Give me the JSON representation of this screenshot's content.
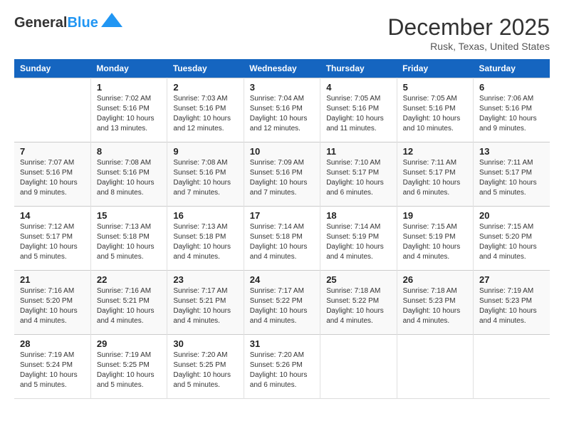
{
  "header": {
    "logo_general": "General",
    "logo_blue": "Blue",
    "month_title": "December 2025",
    "location": "Rusk, Texas, United States"
  },
  "days_of_week": [
    "Sunday",
    "Monday",
    "Tuesday",
    "Wednesday",
    "Thursday",
    "Friday",
    "Saturday"
  ],
  "weeks": [
    [
      {
        "number": "",
        "info": ""
      },
      {
        "number": "1",
        "info": "Sunrise: 7:02 AM\nSunset: 5:16 PM\nDaylight: 10 hours\nand 13 minutes."
      },
      {
        "number": "2",
        "info": "Sunrise: 7:03 AM\nSunset: 5:16 PM\nDaylight: 10 hours\nand 12 minutes."
      },
      {
        "number": "3",
        "info": "Sunrise: 7:04 AM\nSunset: 5:16 PM\nDaylight: 10 hours\nand 12 minutes."
      },
      {
        "number": "4",
        "info": "Sunrise: 7:05 AM\nSunset: 5:16 PM\nDaylight: 10 hours\nand 11 minutes."
      },
      {
        "number": "5",
        "info": "Sunrise: 7:05 AM\nSunset: 5:16 PM\nDaylight: 10 hours\nand 10 minutes."
      },
      {
        "number": "6",
        "info": "Sunrise: 7:06 AM\nSunset: 5:16 PM\nDaylight: 10 hours\nand 9 minutes."
      }
    ],
    [
      {
        "number": "7",
        "info": "Sunrise: 7:07 AM\nSunset: 5:16 PM\nDaylight: 10 hours\nand 9 minutes."
      },
      {
        "number": "8",
        "info": "Sunrise: 7:08 AM\nSunset: 5:16 PM\nDaylight: 10 hours\nand 8 minutes."
      },
      {
        "number": "9",
        "info": "Sunrise: 7:08 AM\nSunset: 5:16 PM\nDaylight: 10 hours\nand 7 minutes."
      },
      {
        "number": "10",
        "info": "Sunrise: 7:09 AM\nSunset: 5:16 PM\nDaylight: 10 hours\nand 7 minutes."
      },
      {
        "number": "11",
        "info": "Sunrise: 7:10 AM\nSunset: 5:17 PM\nDaylight: 10 hours\nand 6 minutes."
      },
      {
        "number": "12",
        "info": "Sunrise: 7:11 AM\nSunset: 5:17 PM\nDaylight: 10 hours\nand 6 minutes."
      },
      {
        "number": "13",
        "info": "Sunrise: 7:11 AM\nSunset: 5:17 PM\nDaylight: 10 hours\nand 5 minutes."
      }
    ],
    [
      {
        "number": "14",
        "info": "Sunrise: 7:12 AM\nSunset: 5:17 PM\nDaylight: 10 hours\nand 5 minutes."
      },
      {
        "number": "15",
        "info": "Sunrise: 7:13 AM\nSunset: 5:18 PM\nDaylight: 10 hours\nand 5 minutes."
      },
      {
        "number": "16",
        "info": "Sunrise: 7:13 AM\nSunset: 5:18 PM\nDaylight: 10 hours\nand 4 minutes."
      },
      {
        "number": "17",
        "info": "Sunrise: 7:14 AM\nSunset: 5:18 PM\nDaylight: 10 hours\nand 4 minutes."
      },
      {
        "number": "18",
        "info": "Sunrise: 7:14 AM\nSunset: 5:19 PM\nDaylight: 10 hours\nand 4 minutes."
      },
      {
        "number": "19",
        "info": "Sunrise: 7:15 AM\nSunset: 5:19 PM\nDaylight: 10 hours\nand 4 minutes."
      },
      {
        "number": "20",
        "info": "Sunrise: 7:15 AM\nSunset: 5:20 PM\nDaylight: 10 hours\nand 4 minutes."
      }
    ],
    [
      {
        "number": "21",
        "info": "Sunrise: 7:16 AM\nSunset: 5:20 PM\nDaylight: 10 hours\nand 4 minutes."
      },
      {
        "number": "22",
        "info": "Sunrise: 7:16 AM\nSunset: 5:21 PM\nDaylight: 10 hours\nand 4 minutes."
      },
      {
        "number": "23",
        "info": "Sunrise: 7:17 AM\nSunset: 5:21 PM\nDaylight: 10 hours\nand 4 minutes."
      },
      {
        "number": "24",
        "info": "Sunrise: 7:17 AM\nSunset: 5:22 PM\nDaylight: 10 hours\nand 4 minutes."
      },
      {
        "number": "25",
        "info": "Sunrise: 7:18 AM\nSunset: 5:22 PM\nDaylight: 10 hours\nand 4 minutes."
      },
      {
        "number": "26",
        "info": "Sunrise: 7:18 AM\nSunset: 5:23 PM\nDaylight: 10 hours\nand 4 minutes."
      },
      {
        "number": "27",
        "info": "Sunrise: 7:19 AM\nSunset: 5:23 PM\nDaylight: 10 hours\nand 4 minutes."
      }
    ],
    [
      {
        "number": "28",
        "info": "Sunrise: 7:19 AM\nSunset: 5:24 PM\nDaylight: 10 hours\nand 5 minutes."
      },
      {
        "number": "29",
        "info": "Sunrise: 7:19 AM\nSunset: 5:25 PM\nDaylight: 10 hours\nand 5 minutes."
      },
      {
        "number": "30",
        "info": "Sunrise: 7:20 AM\nSunset: 5:25 PM\nDaylight: 10 hours\nand 5 minutes."
      },
      {
        "number": "31",
        "info": "Sunrise: 7:20 AM\nSunset: 5:26 PM\nDaylight: 10 hours\nand 6 minutes."
      },
      {
        "number": "",
        "info": ""
      },
      {
        "number": "",
        "info": ""
      },
      {
        "number": "",
        "info": ""
      }
    ]
  ]
}
